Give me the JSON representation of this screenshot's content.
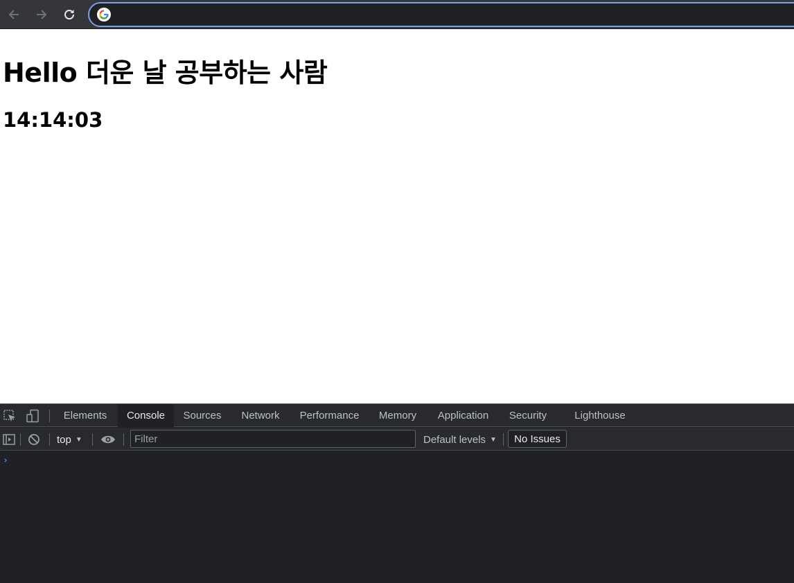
{
  "browser": {
    "address_value": "",
    "icons": {
      "back": "arrow-left-icon",
      "forward": "arrow-right-icon",
      "reload": "reload-icon",
      "site": "google-g-icon"
    }
  },
  "page": {
    "heading": "Hello 더운 날 공부하는 사람",
    "clock": "14:14:03"
  },
  "devtools": {
    "tabs": [
      {
        "label": "Elements",
        "active": false
      },
      {
        "label": "Console",
        "active": true
      },
      {
        "label": "Sources",
        "active": false
      },
      {
        "label": "Network",
        "active": false
      },
      {
        "label": "Performance",
        "active": false
      },
      {
        "label": "Memory",
        "active": false
      },
      {
        "label": "Application",
        "active": false
      },
      {
        "label": "Security",
        "active": false
      },
      {
        "label": "Lighthouse",
        "active": false
      }
    ],
    "console_bar": {
      "context": "top",
      "filter_placeholder": "Filter",
      "levels": "Default levels",
      "issues": "No Issues"
    },
    "prompt_symbol": "›",
    "colors": {
      "accent": "#4b8df8",
      "panel_bg": "#202124",
      "toolbar_bg": "#292a2d"
    }
  }
}
